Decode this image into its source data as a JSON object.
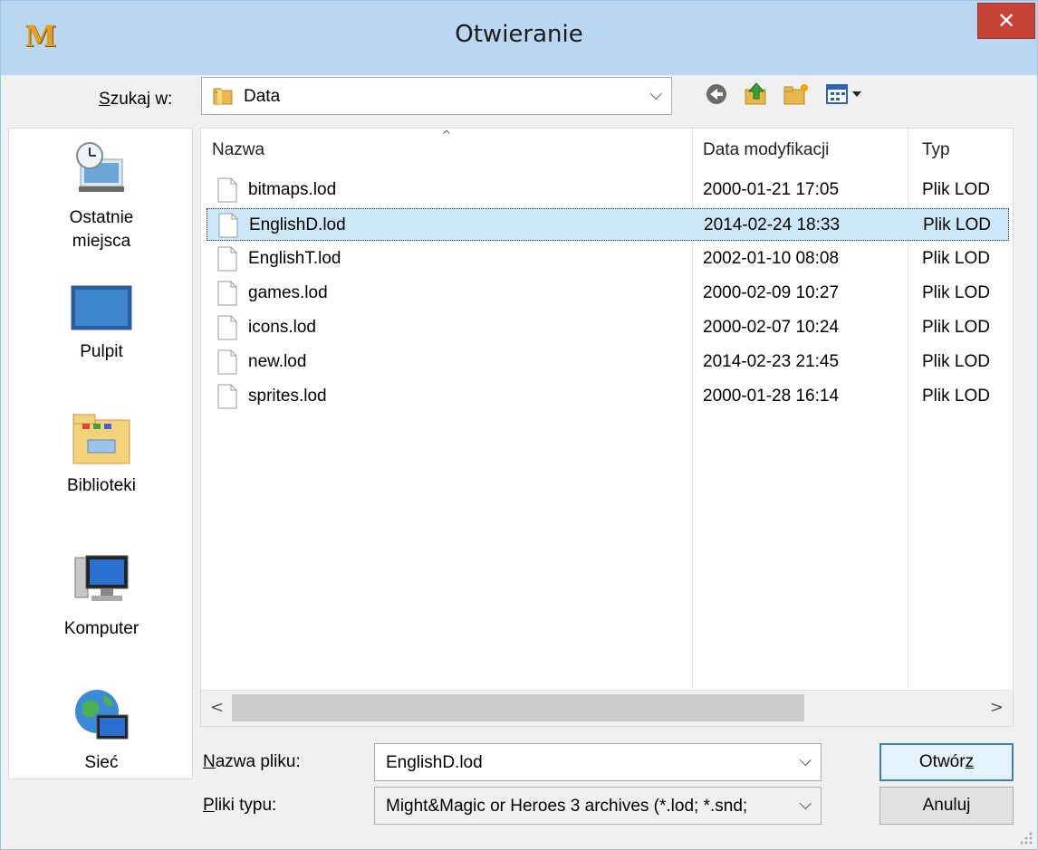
{
  "window": {
    "title": "Otwieranie",
    "app_icon_letter": "M",
    "close_glyph": "✕"
  },
  "lookin": {
    "label_prefix": "S",
    "label_rest": "zukaj w:",
    "value": "Data",
    "dropdown_glyph": "⌵"
  },
  "toolbar": {
    "icons": [
      "back-icon",
      "up-folder-icon",
      "new-folder-icon",
      "view-menu-icon"
    ]
  },
  "places": [
    {
      "label": "Ostatnie\nmiejsca",
      "icon": "recent-places-icon"
    },
    {
      "label": "Pulpit",
      "icon": "desktop-icon"
    },
    {
      "label": "Biblioteki",
      "icon": "libraries-icon"
    },
    {
      "label": "Komputer",
      "icon": "computer-icon"
    },
    {
      "label": "Sieć",
      "icon": "network-icon"
    }
  ],
  "filelist": {
    "columns": [
      "Nazwa",
      "Data modyfikacji",
      "Typ"
    ],
    "sort_glyph": "^",
    "rows": [
      {
        "name": "bitmaps.lod",
        "date": "2000-01-21 17:05",
        "type": "Plik LOD",
        "selected": false
      },
      {
        "name": "EnglishD.lod",
        "date": "2014-02-24 18:33",
        "type": "Plik LOD",
        "selected": true
      },
      {
        "name": "EnglishT.lod",
        "date": "2002-01-10 08:08",
        "type": "Plik LOD",
        "selected": false
      },
      {
        "name": "games.lod",
        "date": "2000-02-09 10:27",
        "type": "Plik LOD",
        "selected": false
      },
      {
        "name": "icons.lod",
        "date": "2000-02-07 10:24",
        "type": "Plik LOD",
        "selected": false
      },
      {
        "name": "new.lod",
        "date": "2014-02-23 21:45",
        "type": "Plik LOD",
        "selected": false
      },
      {
        "name": "sprites.lod",
        "date": "2000-01-28 16:14",
        "type": "Plik LOD",
        "selected": false
      }
    ],
    "scroll_left_glyph": "<",
    "scroll_right_glyph": ">"
  },
  "filename": {
    "label_prefix": "N",
    "label_rest": "azwa pliku:",
    "value": "EnglishD.lod",
    "dropdown_glyph": "⌵"
  },
  "filetype": {
    "label_prefix": "P",
    "label_rest": "liki typu:",
    "value": "Might&Magic or Heroes 3 archives (*.lod; *.snd;",
    "dropdown_glyph": "⌵"
  },
  "buttons": {
    "open_prefix": "Otwór",
    "open_ul": "z",
    "cancel": "Anuluj"
  },
  "colors": {
    "titlebar": "#b9d7f2",
    "close": "#c74338",
    "selection": "#cce8f8"
  }
}
